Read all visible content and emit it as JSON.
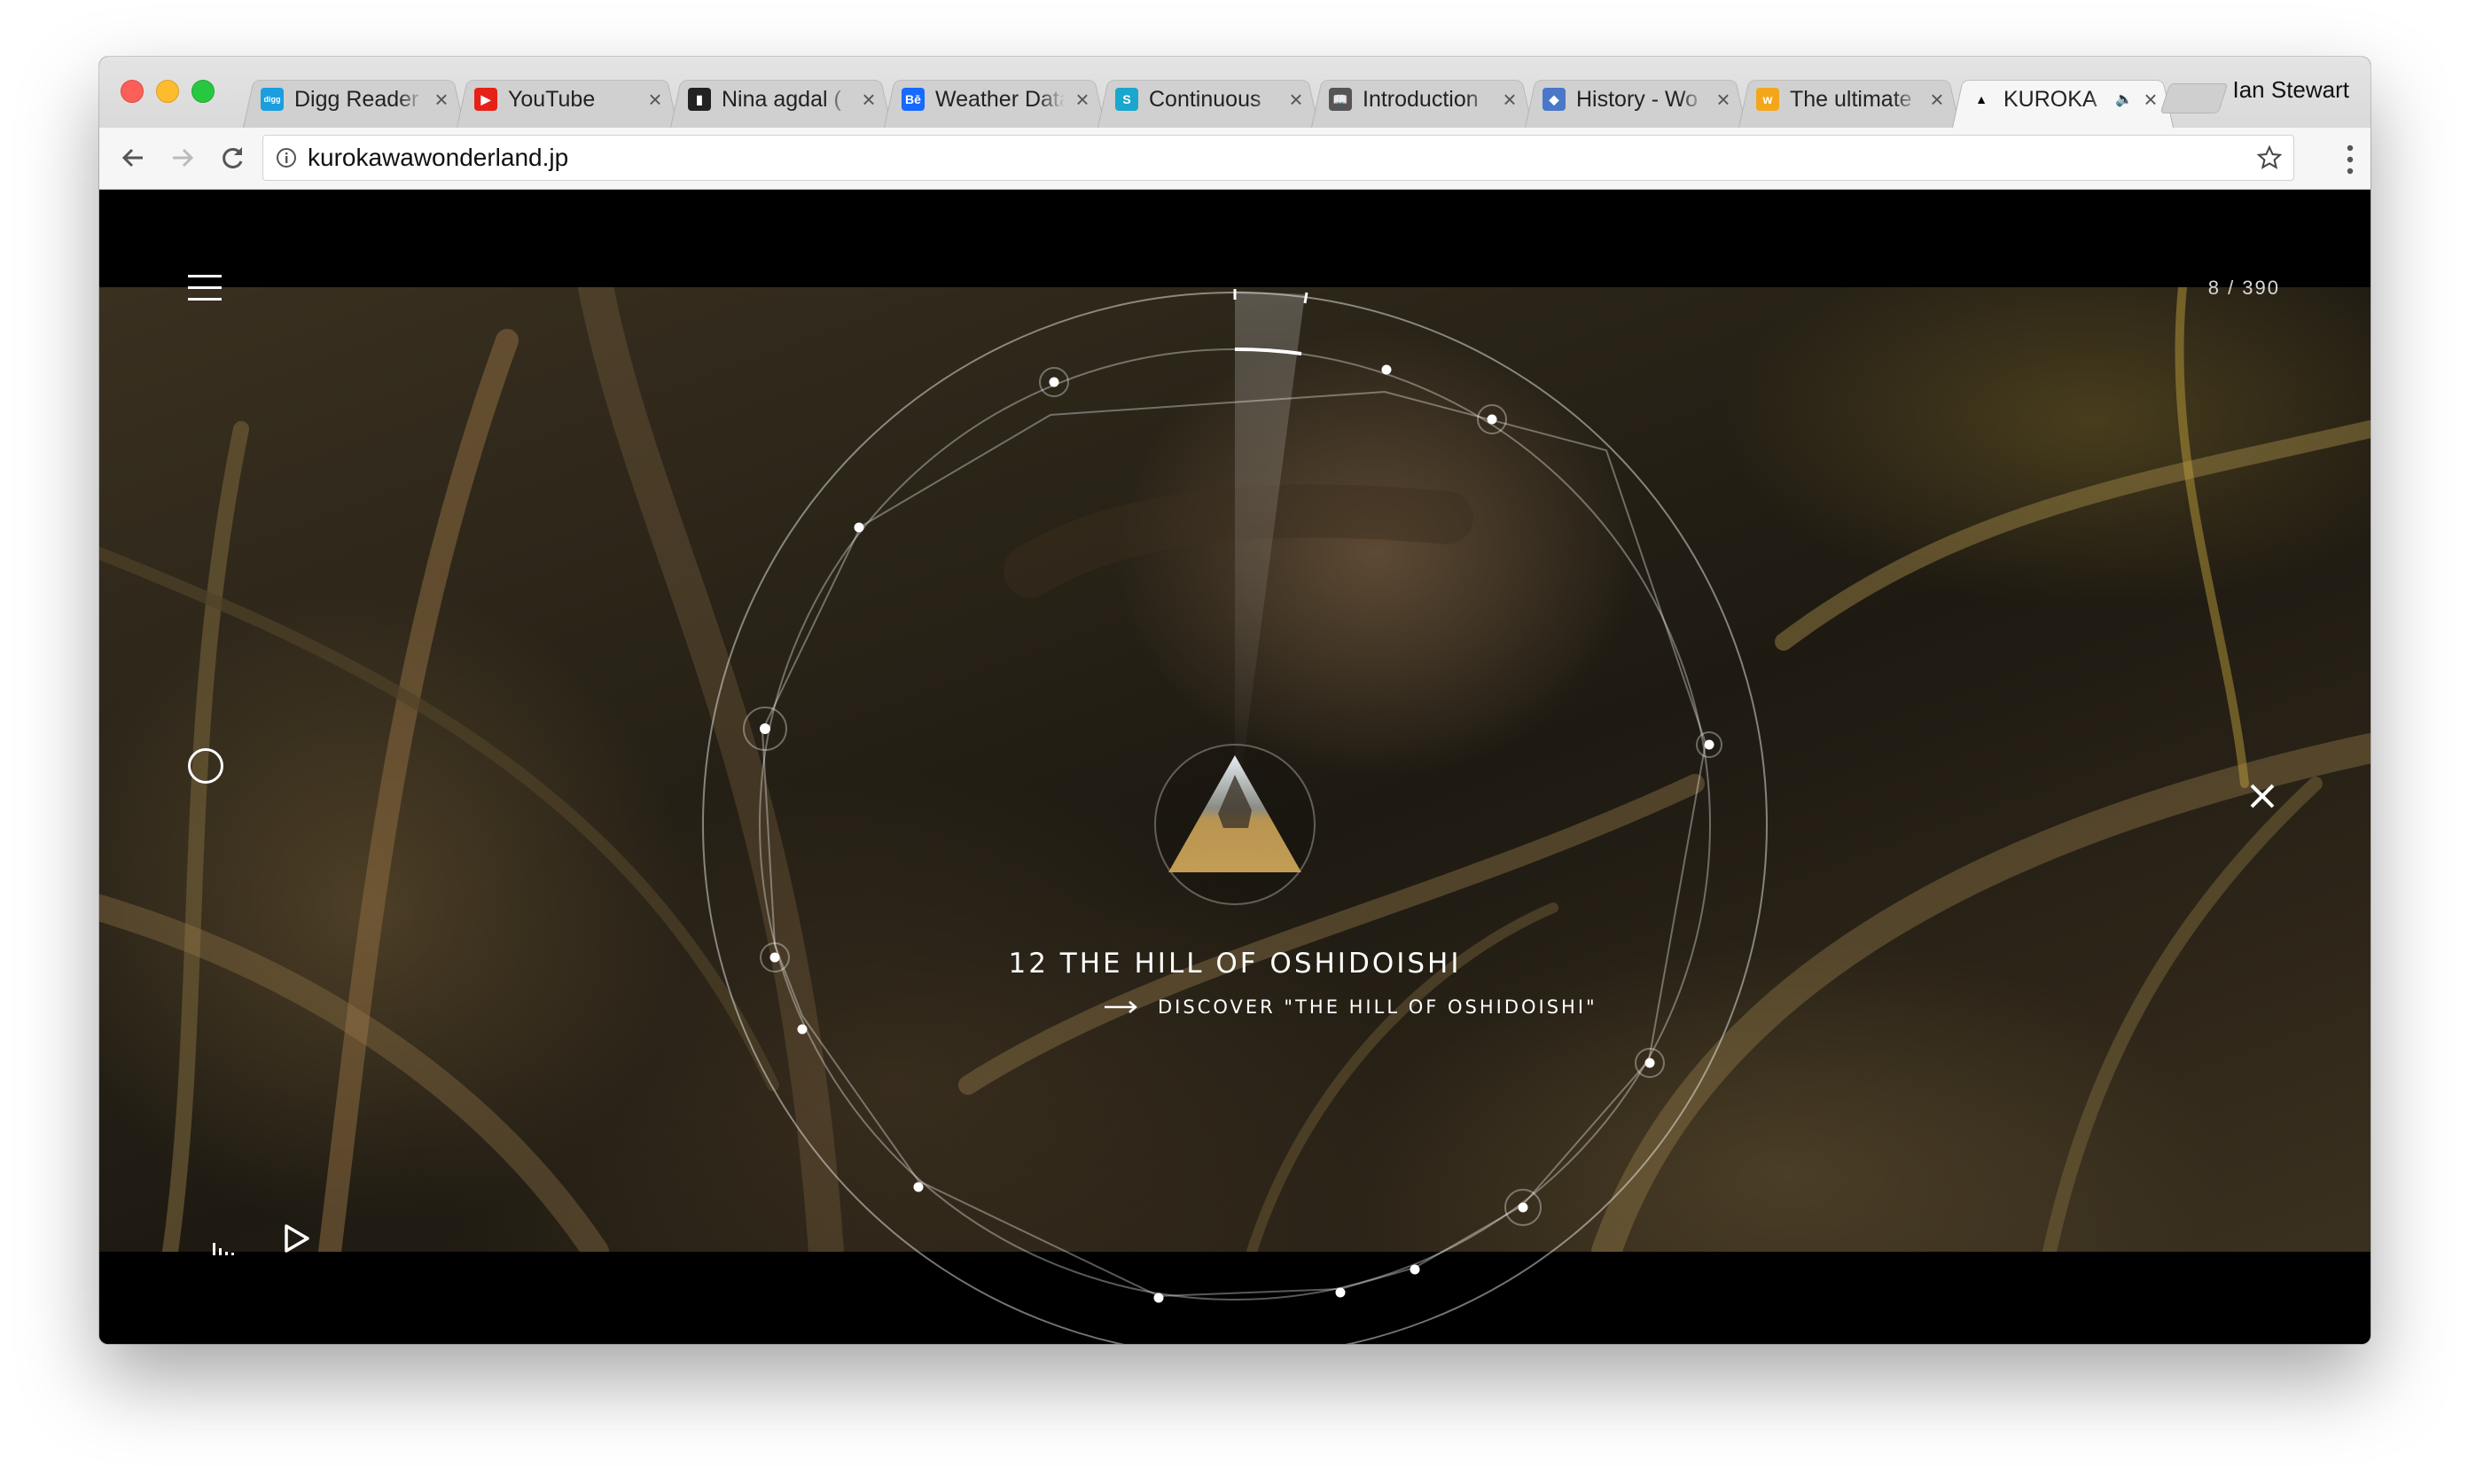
{
  "browser": {
    "tabs": [
      {
        "title": "Digg Reader",
        "favicon": "digg-icon",
        "color": "#1a9ee0",
        "glyph": "digg",
        "active": false
      },
      {
        "title": "YouTube",
        "favicon": "youtube-icon",
        "color": "#e62117",
        "glyph": "▶",
        "active": false
      },
      {
        "title": "Nina agdal (",
        "favicon": "bookmark-icon",
        "color": "#222222",
        "glyph": "▮",
        "active": false
      },
      {
        "title": "Weather Data",
        "favicon": "behance-icon",
        "color": "#1769ff",
        "glyph": "Bē",
        "active": false
      },
      {
        "title": "Continuous",
        "favicon": "semaphore-icon",
        "color": "#19a7ce",
        "glyph": "S",
        "active": false
      },
      {
        "title": "Introduction",
        "favicon": "book-icon",
        "color": "#555555",
        "glyph": "📖",
        "active": false
      },
      {
        "title": "History - Wo",
        "favicon": "stack-icon",
        "color": "#4a78c8",
        "glyph": "◆",
        "active": false
      },
      {
        "title": "The ultimate",
        "favicon": "w-icon",
        "color": "#f2a71b",
        "glyph": "w",
        "active": false
      },
      {
        "title": "KUROKA",
        "favicon": "triangle-icon",
        "color": "#000000",
        "glyph": "▲",
        "active": true
      }
    ],
    "profile_name": "Ian Stewart",
    "url": "kurokawawonderland.jp"
  },
  "page": {
    "counter": "8 / 390",
    "place_title": "12 THE HILL OF OSHIDOISHI",
    "discover_label": "DISCOVER \"THE HILL OF OSHIDOISHI\""
  },
  "colors": {
    "background": "#000000",
    "text": "#ffffff",
    "orbit_line": "rgba(255,255,255,0.45)"
  }
}
